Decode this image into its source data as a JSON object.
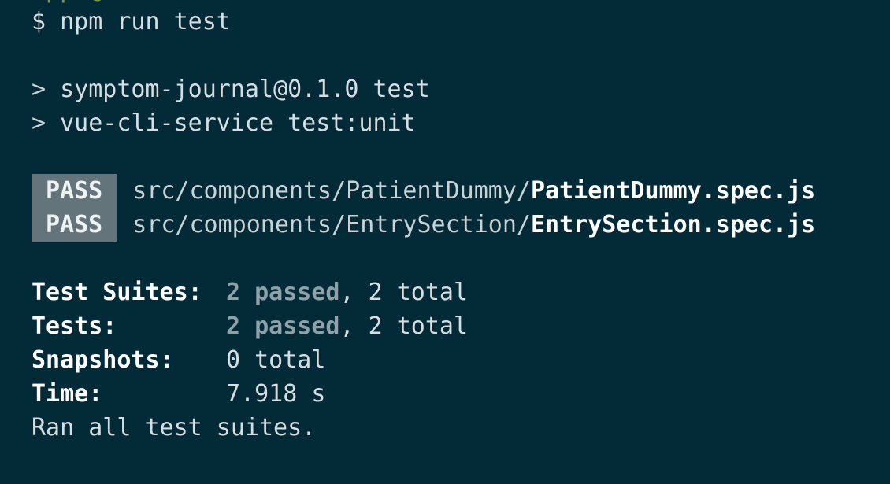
{
  "terminal": {
    "cut_line": "apps@",
    "prompt": {
      "symbol": "$",
      "command": "npm run test"
    },
    "script_lines": [
      {
        "marker": ">",
        "text": "symptom-journal@0.1.0 test"
      },
      {
        "marker": ">",
        "text": "vue-cli-service test:unit"
      }
    ],
    "results": [
      {
        "status": "PASS",
        "dir": "src/components/PatientDummy/",
        "file": "PatientDummy.spec.js"
      },
      {
        "status": "PASS",
        "dir": "src/components/EntrySection/",
        "file": "EntrySection.spec.js"
      }
    ],
    "summary": {
      "suites": {
        "label": "Test Suites:",
        "passed": "2 passed",
        "rest": ", 2 total"
      },
      "tests": {
        "label": "Tests:",
        "passed": "2 passed",
        "rest": ", 2 total"
      },
      "snapshots": {
        "label": "Snapshots:",
        "value": "0 total"
      },
      "time": {
        "label": "Time:",
        "value": "7.918 s"
      },
      "footer": "Ran all test suites."
    }
  },
  "colors": {
    "background": "#022a37",
    "pass_badge": "#63747b",
    "passed_text": "#8ea1a8"
  }
}
